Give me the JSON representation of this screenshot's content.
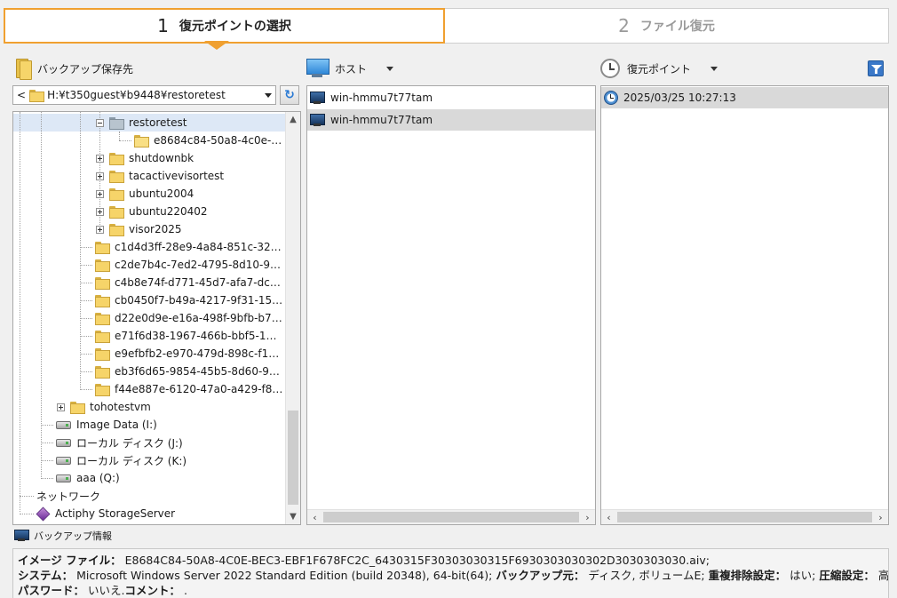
{
  "steps": [
    {
      "num": "1",
      "label": "復元ポイントの選択",
      "active": true
    },
    {
      "num": "2",
      "label": "ファイル復元",
      "active": false
    }
  ],
  "backup_dest": {
    "label": "バックアップ保存先",
    "path_prefix": "<",
    "path": "H:¥t350guest¥b9448¥restoretest"
  },
  "host_header": {
    "label": "ホスト"
  },
  "rp_header": {
    "label": "復元ポイント"
  },
  "tree": {
    "items": [
      {
        "label": "restoretest"
      },
      {
        "label": "e8684c84-50a8-4c0e-b…"
      },
      {
        "label": "shutdownbk"
      },
      {
        "label": "tacactivevisortest"
      },
      {
        "label": "ubuntu2004"
      },
      {
        "label": "ubuntu220402"
      },
      {
        "label": "visor2025"
      },
      {
        "label": "c1d4d3ff-28e9-4a84-851c-32e…"
      },
      {
        "label": "c2de7b4c-7ed2-4795-8d10-90…"
      },
      {
        "label": "c4b8e74f-d771-45d7-afa7-dc5…"
      },
      {
        "label": "cb0450f7-b49a-4217-9f31-156…"
      },
      {
        "label": "d22e0d9e-e16a-498f-9bfb-b76…"
      },
      {
        "label": "e71f6d38-1967-466b-bbf5-1b8…"
      },
      {
        "label": "e9efbfb2-e970-479d-898c-f10…"
      },
      {
        "label": "eb3f6d65-9854-45b5-8d60-9d…"
      },
      {
        "label": "f44e887e-6120-47a0-a429-f89…"
      },
      {
        "label": "tohotestvm"
      },
      {
        "label": "Image Data (I:)"
      },
      {
        "label": "ローカル ディスク (J:)"
      },
      {
        "label": "ローカル ディスク (K:)"
      },
      {
        "label": "aaa (Q:)"
      },
      {
        "label": "ネットワーク"
      },
      {
        "label": "Actiphy StorageServer"
      }
    ]
  },
  "hosts": {
    "items": [
      {
        "label": "win-hmmu7t77tam"
      },
      {
        "label": "win-hmmu7t77tam"
      }
    ]
  },
  "restore_points": {
    "items": [
      {
        "label": "2025/03/25 10:27:13"
      }
    ]
  },
  "info": {
    "header": "バックアップ情報",
    "image_file_label": "イメージ ファイル：",
    "image_file_value": "E8684C84-50A8-4C0E-BEC3-EBF1F678FC2C_6430315F30303030315F6930303030302D3030303030.aiv;",
    "system_label": "システム：",
    "system_value": "Microsoft Windows Server 2022 Standard Edition (build 20348), 64-bit(64);",
    "source_label": "バックアップ元：",
    "source_value": "ディスク, ボリュームE;",
    "dedup_label": "重複排除設定：",
    "dedup_value": "はい;",
    "compress_label": "圧縮設定：",
    "compress_value": "高速;",
    "password_label": "パスワード：",
    "password_value": "いいえ.",
    "comment_label": "コメント：",
    "comment_value": "."
  }
}
